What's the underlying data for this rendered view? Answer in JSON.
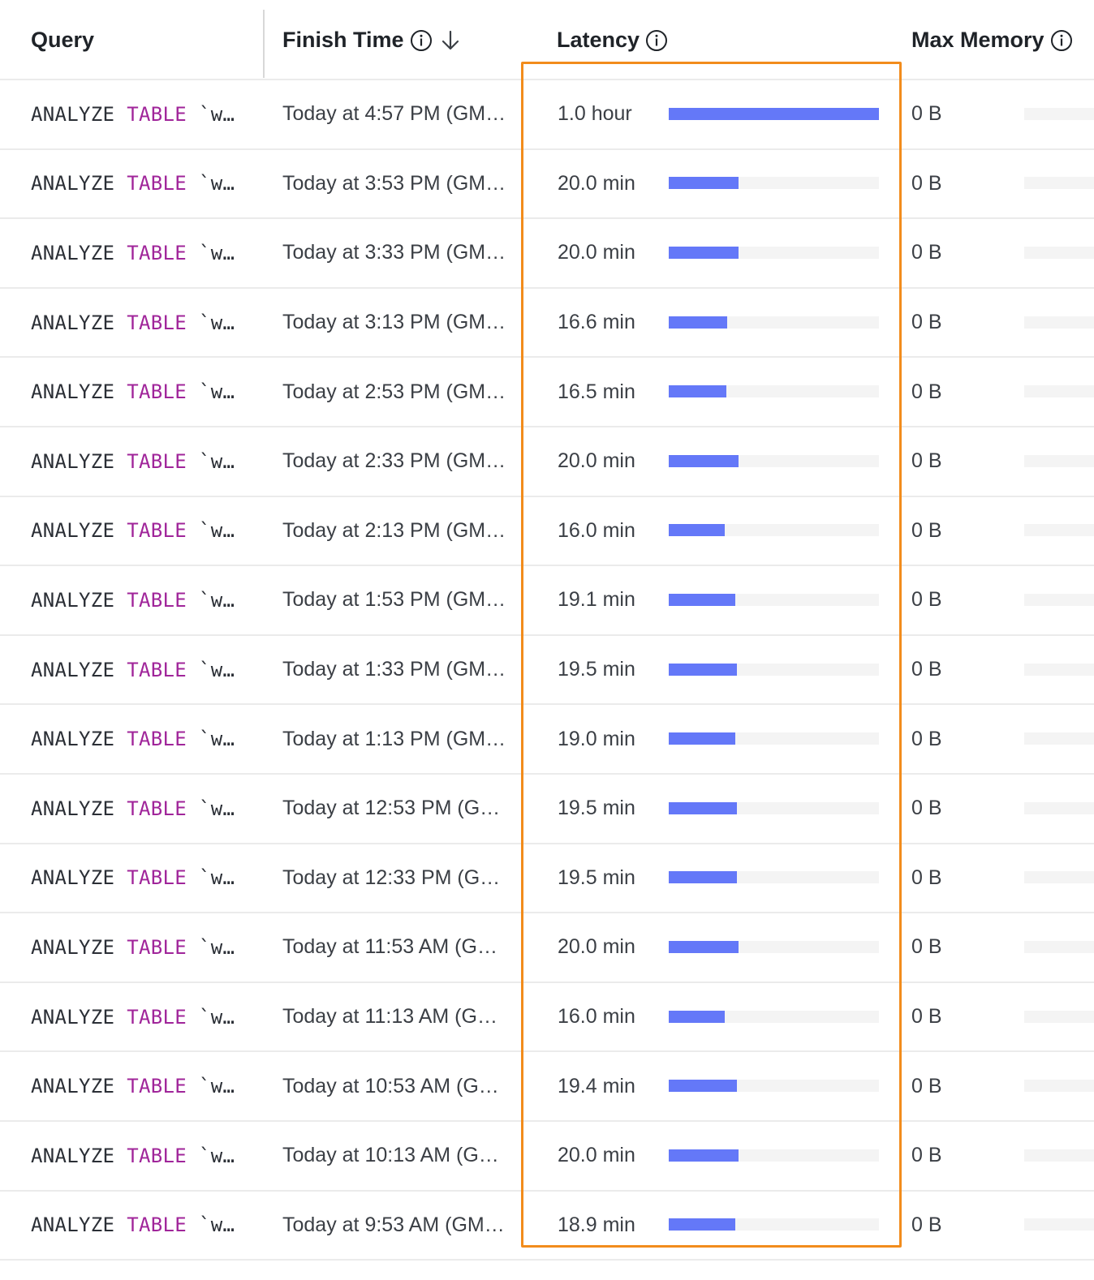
{
  "columns": {
    "query": "Query",
    "finish_time": "Finish Time",
    "latency": "Latency",
    "max_memory": "Max Memory"
  },
  "icons": {
    "finish_info": "info-icon",
    "finish_sort": "arrow-down-icon",
    "latency_info": "info-icon",
    "memory_info": "info-icon"
  },
  "colors": {
    "keyword": "#a0259a",
    "bar": "#6478f8",
    "highlight": "#f28c1c"
  },
  "latency_max_minutes": 60,
  "rows": [
    {
      "query_kw1": "ANALYZE",
      "query_kw2": "TABLE",
      "query_rest": "`w…",
      "finish": "Today at 4:57 PM (GM…",
      "latency": "1.0 hour",
      "latency_minutes": 60,
      "memory": "0 B"
    },
    {
      "query_kw1": "ANALYZE",
      "query_kw2": "TABLE",
      "query_rest": "`w…",
      "finish": "Today at 3:53 PM (GM…",
      "latency": "20.0 min",
      "latency_minutes": 20.0,
      "memory": "0 B"
    },
    {
      "query_kw1": "ANALYZE",
      "query_kw2": "TABLE",
      "query_rest": "`w…",
      "finish": "Today at 3:33 PM (GM…",
      "latency": "20.0 min",
      "latency_minutes": 20.0,
      "memory": "0 B"
    },
    {
      "query_kw1": "ANALYZE",
      "query_kw2": "TABLE",
      "query_rest": "`w…",
      "finish": "Today at 3:13 PM (GM…",
      "latency": "16.6 min",
      "latency_minutes": 16.6,
      "memory": "0 B"
    },
    {
      "query_kw1": "ANALYZE",
      "query_kw2": "TABLE",
      "query_rest": "`w…",
      "finish": "Today at 2:53 PM (GM…",
      "latency": "16.5 min",
      "latency_minutes": 16.5,
      "memory": "0 B"
    },
    {
      "query_kw1": "ANALYZE",
      "query_kw2": "TABLE",
      "query_rest": "`w…",
      "finish": "Today at 2:33 PM (GM…",
      "latency": "20.0 min",
      "latency_minutes": 20.0,
      "memory": "0 B"
    },
    {
      "query_kw1": "ANALYZE",
      "query_kw2": "TABLE",
      "query_rest": "`w…",
      "finish": "Today at 2:13 PM (GM…",
      "latency": "16.0 min",
      "latency_minutes": 16.0,
      "memory": "0 B"
    },
    {
      "query_kw1": "ANALYZE",
      "query_kw2": "TABLE",
      "query_rest": "`w…",
      "finish": "Today at 1:53 PM (GM…",
      "latency": "19.1 min",
      "latency_minutes": 19.1,
      "memory": "0 B"
    },
    {
      "query_kw1": "ANALYZE",
      "query_kw2": "TABLE",
      "query_rest": "`w…",
      "finish": "Today at 1:33 PM (GM…",
      "latency": "19.5 min",
      "latency_minutes": 19.5,
      "memory": "0 B"
    },
    {
      "query_kw1": "ANALYZE",
      "query_kw2": "TABLE",
      "query_rest": "`w…",
      "finish": "Today at 1:13 PM (GM…",
      "latency": "19.0 min",
      "latency_minutes": 19.0,
      "memory": "0 B"
    },
    {
      "query_kw1": "ANALYZE",
      "query_kw2": "TABLE",
      "query_rest": "`w…",
      "finish": "Today at 12:53 PM (G…",
      "latency": "19.5 min",
      "latency_minutes": 19.5,
      "memory": "0 B"
    },
    {
      "query_kw1": "ANALYZE",
      "query_kw2": "TABLE",
      "query_rest": "`w…",
      "finish": "Today at 12:33 PM (G…",
      "latency": "19.5 min",
      "latency_minutes": 19.5,
      "memory": "0 B"
    },
    {
      "query_kw1": "ANALYZE",
      "query_kw2": "TABLE",
      "query_rest": "`w…",
      "finish": "Today at 11:53 AM (G…",
      "latency": "20.0 min",
      "latency_minutes": 20.0,
      "memory": "0 B"
    },
    {
      "query_kw1": "ANALYZE",
      "query_kw2": "TABLE",
      "query_rest": "`w…",
      "finish": "Today at 11:13 AM (G…",
      "latency": "16.0 min",
      "latency_minutes": 16.0,
      "memory": "0 B"
    },
    {
      "query_kw1": "ANALYZE",
      "query_kw2": "TABLE",
      "query_rest": "`w…",
      "finish": "Today at 10:53 AM (G…",
      "latency": "19.4 min",
      "latency_minutes": 19.4,
      "memory": "0 B"
    },
    {
      "query_kw1": "ANALYZE",
      "query_kw2": "TABLE",
      "query_rest": "`w…",
      "finish": "Today at 10:13 AM (G…",
      "latency": "20.0 min",
      "latency_minutes": 20.0,
      "memory": "0 B"
    },
    {
      "query_kw1": "ANALYZE",
      "query_kw2": "TABLE",
      "query_rest": "`w…",
      "finish": "Today at 9:53 AM (GM…",
      "latency": "18.9 min",
      "latency_minutes": 18.9,
      "memory": "0 B"
    }
  ]
}
